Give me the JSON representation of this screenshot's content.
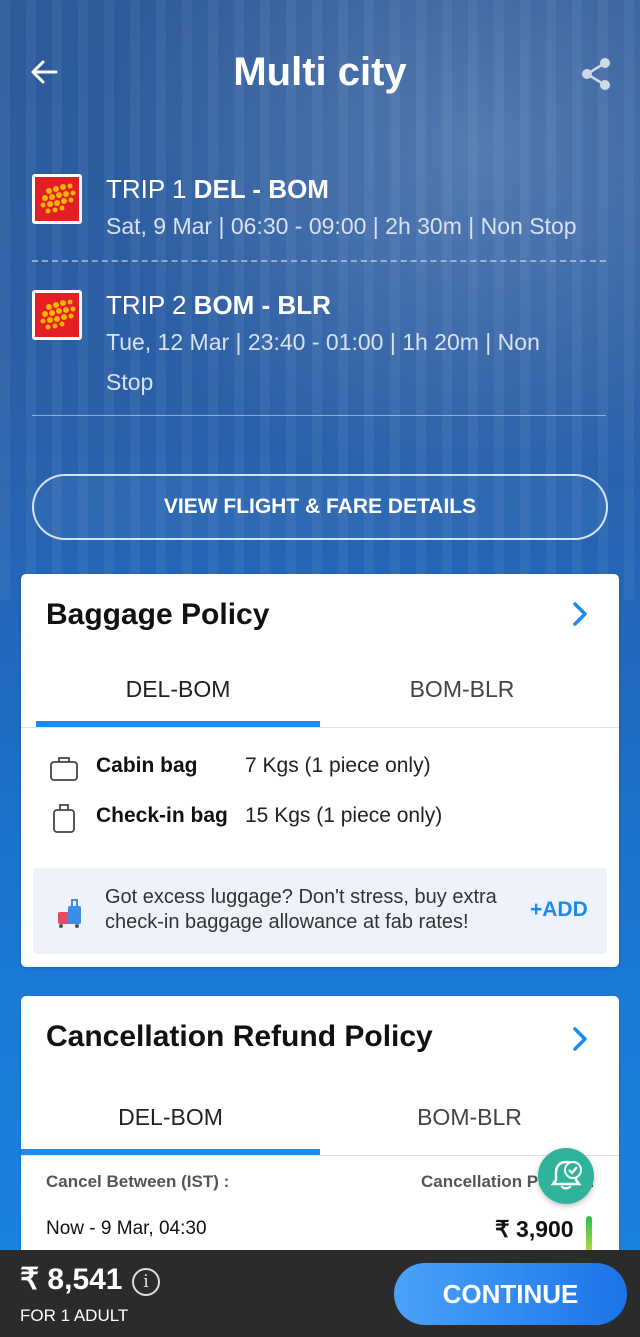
{
  "header": {
    "title": "Multi city"
  },
  "trips": [
    {
      "label": "TRIP 1",
      "route": "DEL - BOM",
      "details": "Sat, 9 Mar | 06:30 - 09:00 | 2h 30m | Non Stop",
      "details_a": "",
      "details_b": ""
    },
    {
      "label": "TRIP 2",
      "route": "BOM - BLR",
      "details_a": "Tue, 12 Mar | 23:40 - 01:00 | 1h 20m | Non",
      "details_b": "Stop"
    }
  ],
  "fare_button": "VIEW FLIGHT & FARE DETAILS",
  "baggage": {
    "title": "Baggage Policy",
    "tabs": [
      "DEL-BOM",
      "BOM-BLR"
    ],
    "rows": [
      {
        "label": "Cabin bag",
        "value": "7 Kgs (1 piece only)",
        "icon": "cabin-bag-icon"
      },
      {
        "label": "Check-in bag",
        "value": "15 Kgs (1 piece only)",
        "icon": "checkin-bag-icon"
      }
    ],
    "promo": {
      "line1": "Got excess luggage? Don't stress, buy extra",
      "line2": "check-in baggage allowance at fab rates!",
      "action": "+ADD"
    }
  },
  "cancellation": {
    "title": "Cancellation Refund Policy",
    "tabs": [
      "DEL-BOM",
      "BOM-BLR"
    ],
    "col_left": "Cancel Between (IST) :",
    "col_right": "Cancellation Pe",
    "col_right_end": ":",
    "rows": [
      {
        "from_bold": "Now - 9 Mar",
        "from_rest": ", 04:30",
        "amount": "₹ 3,900"
      }
    ]
  },
  "footer": {
    "price": "₹ 8,541",
    "pax": "FOR 1 ADULT",
    "continue": "CONTINUE"
  },
  "colors": {
    "accent": "#1a8bf0",
    "cta_start": "#4aa3f8",
    "cta_end": "#1b74e8",
    "footer_bg": "#2b2b2b",
    "logo_red": "#e31e24"
  }
}
